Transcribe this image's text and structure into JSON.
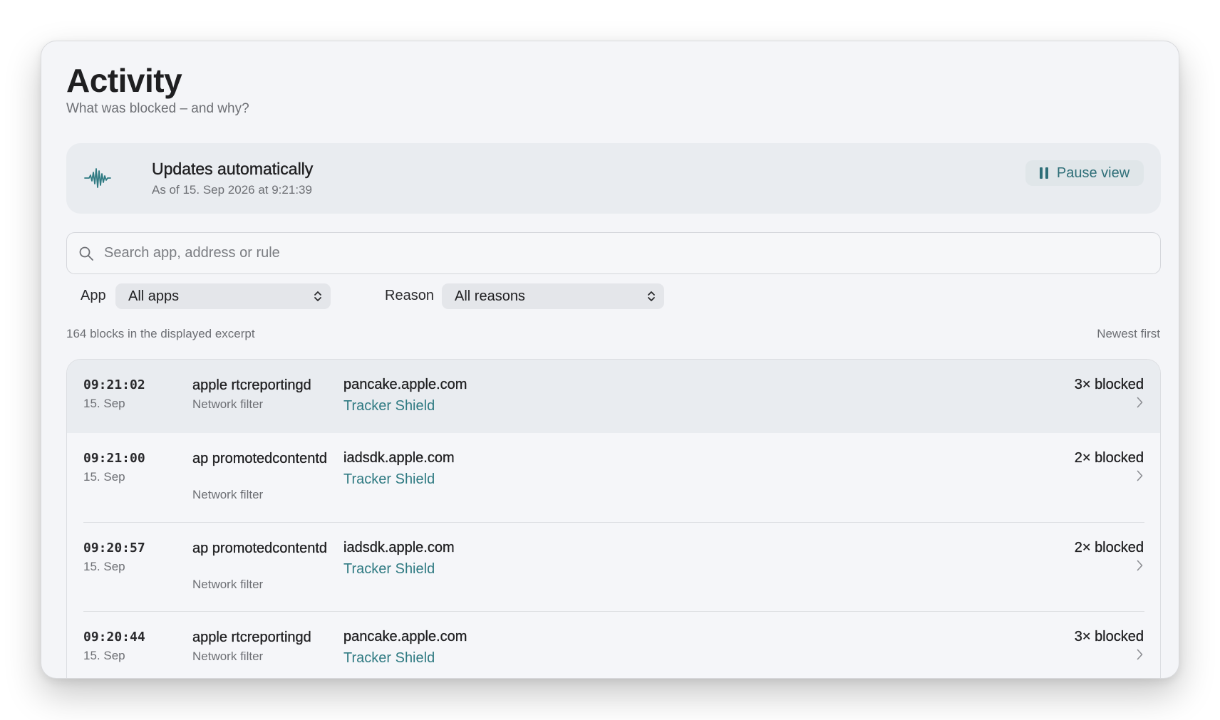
{
  "header": {
    "title": "Activity",
    "subtitle": "What was blocked – and why?"
  },
  "status": {
    "icon": "waveform-icon",
    "title": "Updates automatically",
    "timestamp": "As of 15. Sep 2026 at 9:21:39",
    "pause_label": "Pause view",
    "pause_icon": "pause-icon"
  },
  "search": {
    "placeholder": "Search app, address or rule",
    "value": ""
  },
  "filters": {
    "app_label": "App",
    "app_value": "All apps",
    "reason_label": "Reason",
    "reason_value": "All reasons"
  },
  "summary": {
    "count_text": "164 blocks in the displayed excerpt",
    "sort_text": "Newest first"
  },
  "colors": {
    "accent": "#2f7a82",
    "background": "#f4f5f8",
    "card": "#e9ecf0"
  },
  "rows": [
    {
      "time": "09:21:02",
      "date": "15. Sep",
      "app": "apple rtcreportingd",
      "source": "Network filter",
      "host": "pancake.apple.com",
      "rule": "Tracker Shield",
      "count": "3× blocked"
    },
    {
      "time": "09:21:00",
      "date": "15. Sep",
      "app": "ap promotedcontentd",
      "source": "Network filter",
      "host": "iadsdk.apple.com",
      "rule": "Tracker Shield",
      "count": "2× blocked"
    },
    {
      "time": "09:20:57",
      "date": "15. Sep",
      "app": "ap promotedcontentd",
      "source": "Network filter",
      "host": "iadsdk.apple.com",
      "rule": "Tracker Shield",
      "count": "2× blocked"
    },
    {
      "time": "09:20:44",
      "date": "15. Sep",
      "app": "apple rtcreportingd",
      "source": "Network filter",
      "host": "pancake.apple.com",
      "rule": "Tracker Shield",
      "count": "3× blocked"
    }
  ]
}
